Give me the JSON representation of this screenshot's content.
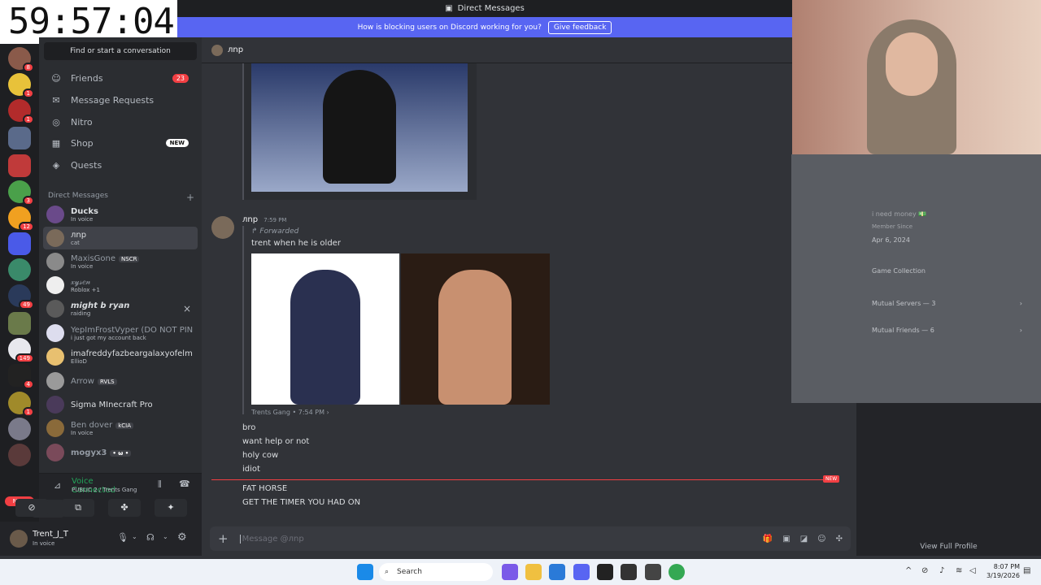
{
  "timer": "59:57:04",
  "window": {
    "title": "Direct Messages"
  },
  "banner": {
    "text": "How is blocking users on Discord working for you?",
    "button": "Give feedback"
  },
  "sidebar": {
    "find": "Find or start a conversation",
    "nav": [
      {
        "label": "Friends",
        "badge": "23"
      },
      {
        "label": "Message Requests"
      },
      {
        "label": "Nitro"
      },
      {
        "label": "Shop",
        "badge_new": "NEW"
      },
      {
        "label": "Quests"
      }
    ],
    "dm_header": "Direct Messages",
    "dm_add": "+",
    "dms": [
      {
        "name": "Ducks",
        "sub": "In voice"
      },
      {
        "name": "лnр",
        "sub": "cat"
      },
      {
        "name": "MaxisGone",
        "tag": "NSCR",
        "sub": "In voice"
      },
      {
        "name": "𝓍𝓎𝓈𝑒𝓃",
        "sub": "Roblox +1"
      },
      {
        "name": "might b ryan",
        "sub": "raiding"
      },
      {
        "name": "YepImFrostVyper (DO NOT PIN...",
        "sub": "i just got my account back"
      },
      {
        "name": "imafreddyfazbeargalaxyofelmo...",
        "sub": "EllioD"
      },
      {
        "name": "Arrow",
        "tag": "RVLS",
        "sub": ""
      },
      {
        "name": "Sigma MInecraft Pro",
        "sub": ""
      },
      {
        "name": "Ben dover",
        "tag": "kCIA",
        "sub": "In voice"
      },
      {
        "name": "mogyx3",
        "tag": "• ω •",
        "sub": ""
      }
    ],
    "server_badges": [
      "8",
      "1",
      "1",
      "3",
      "12",
      "49",
      "149",
      "4",
      "1"
    ],
    "new_badge": "NEW"
  },
  "voice": {
    "status": "Voice Connected",
    "channel": "PUBLIC 2 / Trents Gang"
  },
  "user": {
    "name": "Trent_J_T",
    "status": "In voice"
  },
  "chat": {
    "header_name": "лnр",
    "author": "лnр",
    "time": "7:59 PM",
    "forwarded_label": "Forwarded",
    "forwarded_text": "trent when he is older",
    "forward_source": "Trents Gang",
    "forward_time": "7:54 PM",
    "messages": [
      "bro",
      "want help or not",
      "holy cow",
      "idiot"
    ],
    "new_label": "NEW",
    "new_messages": [
      "FAT HORSE",
      "GET THE TIMER YOU HAD ON"
    ],
    "input_placeholder": "Message @лnр"
  },
  "profile": {
    "about": "i need money 💵",
    "member_since_label": "Member Since",
    "member_since": "Apr 6, 2024",
    "game_collection": "Game Collection",
    "mutual_servers": "Mutual Servers — 3",
    "mutual_friends": "Mutual Friends — 6",
    "view_full": "View Full Profile"
  },
  "taskbar": {
    "search": "Search",
    "time": "8:07 PM",
    "date": "3/19/2026"
  },
  "colors": {
    "blurple": "#5865f2",
    "red": "#f23f43",
    "green": "#23a55a"
  }
}
